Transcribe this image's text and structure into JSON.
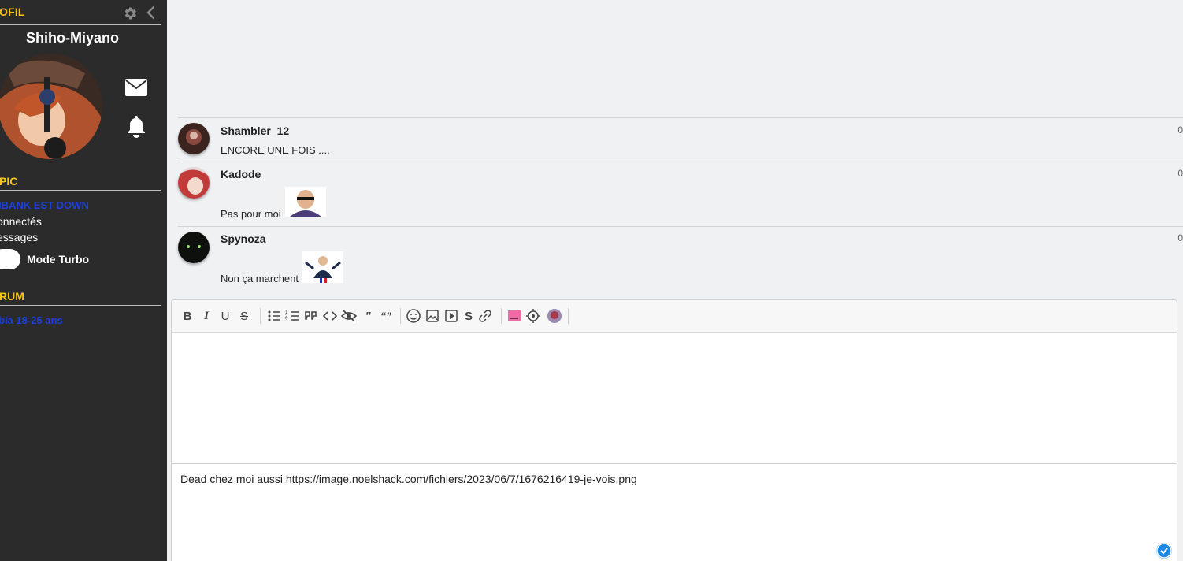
{
  "sidebar": {
    "profile_title": "OFIL",
    "username": "Shiho-Miyano",
    "topic_title": "PIC",
    "topic_link": "IBANK EST DOWN",
    "connected_text": "onnectés",
    "messages_text": "essages",
    "turbo_label": "Mode Turbo",
    "forum_title": "RUM",
    "forum_link": "bla 18-25 ans"
  },
  "messages": [
    {
      "author": "Shambler_12",
      "text": "ENCORE UNE FOIS ....",
      "count": "0"
    },
    {
      "author": "Kadode",
      "text": "Pas pour moi",
      "count": "0"
    },
    {
      "author": "Spynoza",
      "text": "Non ça marchent",
      "count": "0"
    }
  ],
  "editor": {
    "toolbar": [
      "bold-icon",
      "italic-icon",
      "underline-icon",
      "strikethrough-icon",
      "bullet-list-icon",
      "numbered-list-icon",
      "quote-icon",
      "code-icon",
      "spoiler-icon",
      "inline-quote-icon",
      "double-quote-icon",
      "smiley-icon",
      "image-icon",
      "video-icon",
      "sticker-icon",
      "link-icon",
      "color-icon",
      "settings-icon",
      "avatar-icon"
    ],
    "preview_text": "Dead chez moi aussi https://image.noelshack.com/fichiers/2023/06/7/1676216419-je-vois.png"
  },
  "colors": {
    "sidebar_bg": "#2b2b2b",
    "accent_yellow": "#f5c518",
    "link_blue": "#1e3fd9",
    "page_bg": "#f0f1f3"
  }
}
